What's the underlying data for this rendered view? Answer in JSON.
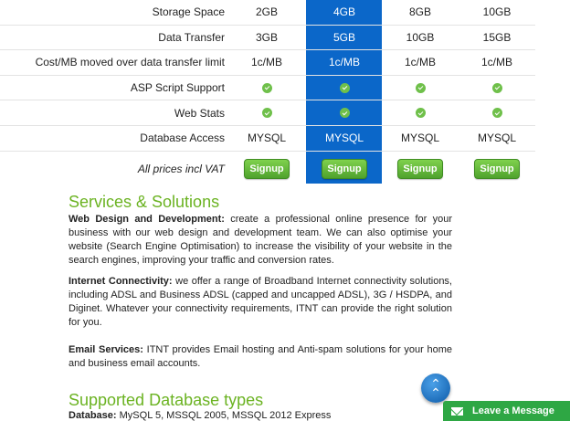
{
  "pricing": {
    "rows": [
      {
        "label": "Storage Space",
        "values": [
          "2GB",
          "4GB",
          "8GB",
          "10GB"
        ]
      },
      {
        "label": "Data Transfer",
        "values": [
          "3GB",
          "5GB",
          "10GB",
          "15GB"
        ]
      },
      {
        "label": "Cost/MB moved over data transfer limit",
        "values": [
          "1c/MB",
          "1c/MB",
          "1c/MB",
          "1c/MB"
        ]
      },
      {
        "label": "ASP Script Support",
        "values": [
          "check",
          "check",
          "check",
          "check"
        ]
      },
      {
        "label": "Web Stats",
        "values": [
          "check",
          "check",
          "check",
          "check"
        ]
      },
      {
        "label": "Database Access",
        "values": [
          "MYSQL",
          "MYSQL",
          "MYSQL",
          "MYSQL"
        ]
      }
    ],
    "footer_label": "All prices incl VAT",
    "signup_label": "Signup",
    "highlight_color": "#0b67c9",
    "check_color": "#6fc04a"
  },
  "services": {
    "heading": "Services & Solutions",
    "items": [
      {
        "title": "Web Design and Development:",
        "text": " create a professional online presence for your business with our web design and development team. We can also optimise your website (Search Engine Optimisation) to increase the visibility of your website in the search engines, improving your traffic and conversion rates."
      },
      {
        "title": "Internet Connectivity:",
        "text": " we offer a range of Broadband Internet connectivity solutions, including ADSL and Business ADSL (capped and uncapped ADSL), 3G / HSDPA, and Diginet. Whatever your connectivity requirements, ITNT can provide the right solution for you."
      },
      {
        "title": "Email Services:",
        "text": " ITNT provides Email hosting and Anti-spam solutions for your home and business email accounts."
      }
    ]
  },
  "databases": {
    "heading": "Supported Database types",
    "title": "Database:",
    "text": " MySQL 5, MSSQL 2005, MSSQL 2012 Express"
  },
  "widgets": {
    "scroll_top_icon": "double-chevron-up-icon",
    "leave_message_label": "Leave a Message",
    "brand_green": "#6bb322"
  }
}
